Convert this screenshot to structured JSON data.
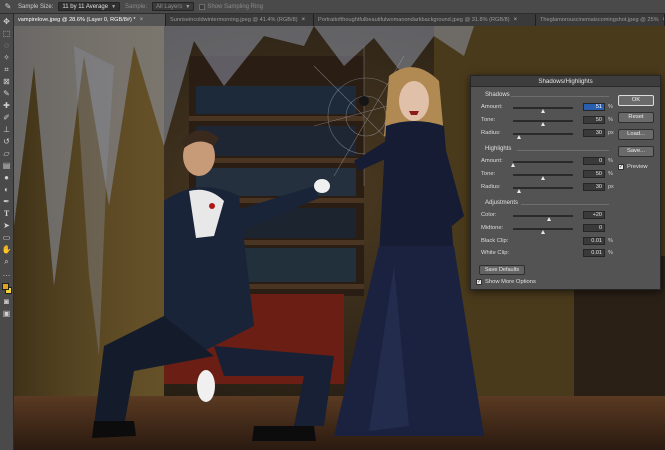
{
  "options_bar": {
    "sample_size_label": "Sample Size:",
    "sample_size_value": "11 by 11 Average",
    "sample_label": "Sample:",
    "sample_value": "All Layers",
    "show_ring_label": "Show Sampling Ring"
  },
  "tabs": [
    {
      "label": "vampirelove.jpeg @ 28.6% (Layer 0, RGB/8#) *",
      "active": true
    },
    {
      "label": "Sunriseincoldwintermorning.jpeg @ 41.4% (RGB/8)",
      "active": false
    },
    {
      "label": "Portraitofthoughtfulbeautifulwomanondarkbackground.jpeg @ 31.8% (RGB/8)",
      "active": false
    },
    {
      "label": "Theglamorouscinemaiscomingshot.jpeg @ 25%",
      "active": false
    }
  ],
  "tab_close": "×",
  "colors": {
    "foreground": "#e0a21a",
    "background": "#f4d23a",
    "accent_focus": "#2a5fb0"
  },
  "dialog": {
    "title": "Shadows/Highlights",
    "shadows": {
      "group_label": "Shadows",
      "amount": {
        "label": "Amount:",
        "value": "51",
        "unit": "%",
        "fraction": 0.51
      },
      "tone": {
        "label": "Tone:",
        "value": "50",
        "unit": "%",
        "fraction": 0.5
      },
      "radius": {
        "label": "Radius:",
        "value": "30",
        "unit": "px",
        "fraction": 0.1
      }
    },
    "highlights": {
      "group_label": "Highlights",
      "amount": {
        "label": "Amount:",
        "value": "0",
        "unit": "%",
        "fraction": 0.0
      },
      "tone": {
        "label": "Tone:",
        "value": "50",
        "unit": "%",
        "fraction": 0.5
      },
      "radius": {
        "label": "Radius:",
        "value": "30",
        "unit": "px",
        "fraction": 0.1
      }
    },
    "adjustments": {
      "group_label": "Adjustments",
      "color": {
        "label": "Color:",
        "value": "+20",
        "unit": "",
        "fraction": 0.6
      },
      "midtone": {
        "label": "Midtone:",
        "value": "0",
        "unit": "",
        "fraction": 0.5
      },
      "black_clip": {
        "label": "Black Clip:",
        "value": "0.01",
        "unit": "%"
      },
      "white_clip": {
        "label": "White Clip:",
        "value": "0.01",
        "unit": "%"
      }
    },
    "buttons": {
      "ok": "OK",
      "reset": "Reset",
      "load": "Load...",
      "save": "Save..."
    },
    "preview_label": "Preview",
    "save_defaults": "Save Defaults",
    "show_more": "Show More Options"
  }
}
